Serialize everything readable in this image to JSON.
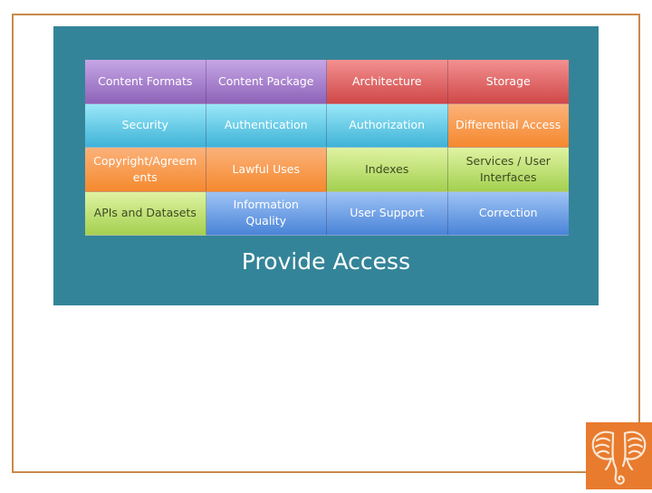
{
  "slide": {
    "title": "Provide Access",
    "colors": {
      "frame": "#c98a4b",
      "panel": "#348499",
      "logo_bg": "#e87b2e"
    },
    "grid": [
      [
        {
          "label": "Content Formats",
          "color": "purple"
        },
        {
          "label": "Content Package",
          "color": "purple"
        },
        {
          "label": "Architecture",
          "color": "red"
        },
        {
          "label": "Storage",
          "color": "red"
        }
      ],
      [
        {
          "label": "Security",
          "color": "cyan"
        },
        {
          "label": "Authentication",
          "color": "cyan"
        },
        {
          "label": "Authorization",
          "color": "cyan"
        },
        {
          "label": "Differential Access",
          "color": "orange"
        }
      ],
      [
        {
          "label": "Copyright/Agreem ents",
          "color": "orange"
        },
        {
          "label": "Lawful Uses",
          "color": "orange"
        },
        {
          "label": "Indexes",
          "color": "green"
        },
        {
          "label": "Services / User Interfaces",
          "color": "green"
        }
      ],
      [
        {
          "label": "APIs and Datasets",
          "color": "green"
        },
        {
          "label": "Information Quality",
          "color": "blue"
        },
        {
          "label": "User Support",
          "color": "blue"
        },
        {
          "label": "Correction",
          "color": "blue"
        }
      ]
    ],
    "logo": {
      "icon": "elephant-icon"
    }
  }
}
